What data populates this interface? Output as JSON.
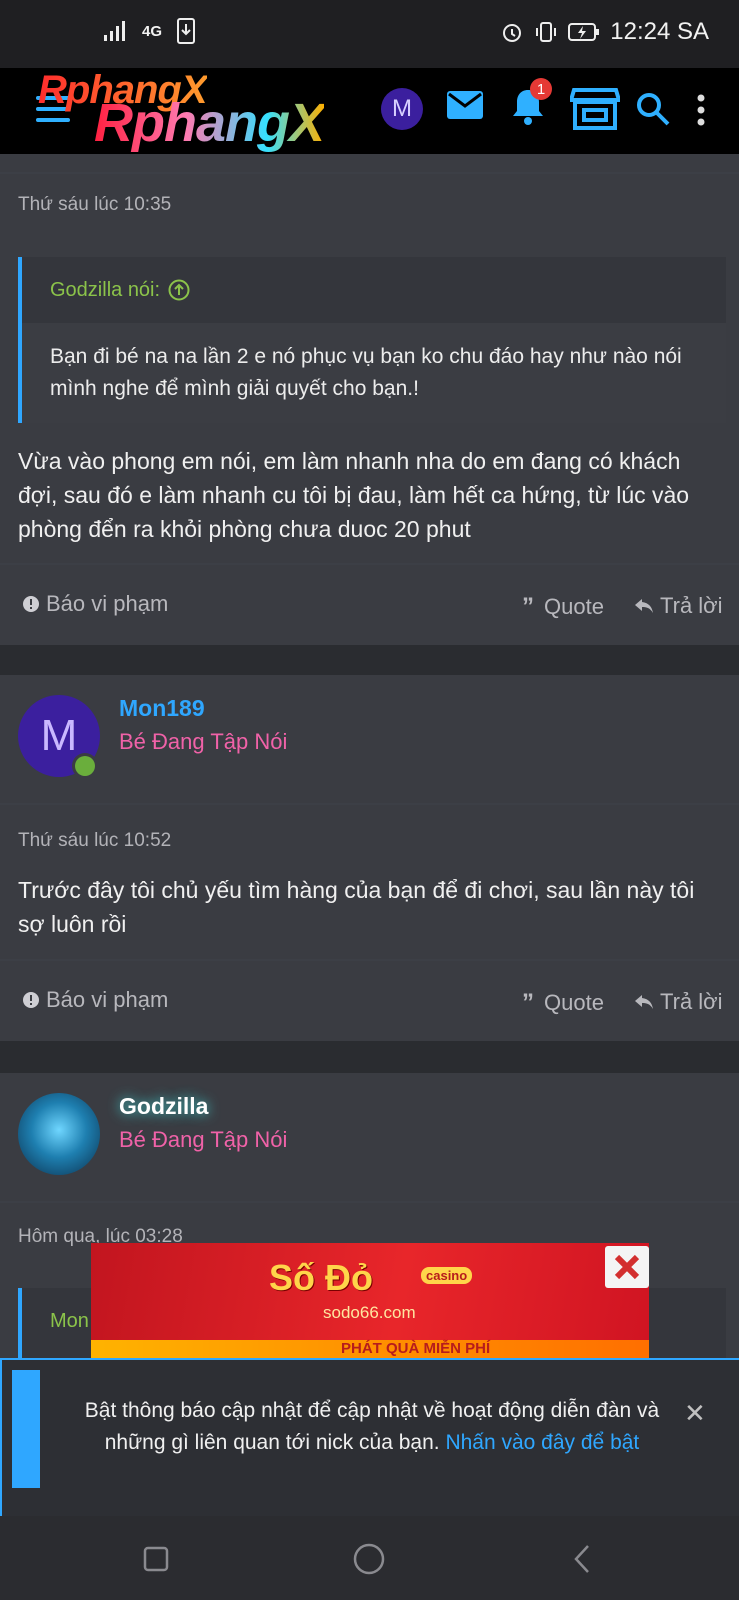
{
  "status_bar": {
    "network": "4G",
    "time": "12:24 SA"
  },
  "header": {
    "logo": "RphangX",
    "avatar_letter": "M",
    "notification_count": "1"
  },
  "post1": {
    "timestamp": "Thứ sáu lúc 10:35",
    "quote_author": "Godzilla nói:",
    "quote_text": "Bạn đi bé na na lần 2 e nó phục vụ bạn ko chu đáo hay như nào nói mình nghe để mình giải quyết cho bạn.!",
    "body": "Vừa vào phong em nói, em làm nhanh nha do em đang có khách đợi, sau đó e làm nhanh cu tôi bị đau, làm hết ca hứng, từ lúc vào phòng đển ra khỏi phòng chưa duoc 20 phut"
  },
  "actions": {
    "report": "Báo vi phạm",
    "quote": "Quote",
    "reply": "Trả lời"
  },
  "post2": {
    "avatar_letter": "M",
    "username": "Mon189",
    "user_title": "Bé Đang Tập Nói",
    "timestamp": "Thứ sáu lúc 10:52",
    "body": "Trước đây tôi chủ yếu tìm hàng của bạn để đi chơi, sau lần này tôi sợ luôn rồi"
  },
  "post3": {
    "username": "Godzilla",
    "user_title": "Bé Đang Tập Nói",
    "timestamp": "Hôm qua, lúc 03:28",
    "quote_author_partial": "Mon"
  },
  "ad": {
    "brand": "Số Đỏ",
    "badge": "casino",
    "site": "sodo66.com",
    "strip_text": "PHÁT QUÀ MIỄN PHÍ"
  },
  "notice": {
    "text": "Bật thông báo cập nhật để cập nhật về hoạt động diễn đàn và những gì liên quan tới nick của bạn.",
    "link": "Nhấn vào đây để bật"
  },
  "colors": {
    "accent": "#2fa7ff",
    "user_title": "#f062a8",
    "quote_author": "#8bc34a",
    "background": "#3a3c42"
  }
}
